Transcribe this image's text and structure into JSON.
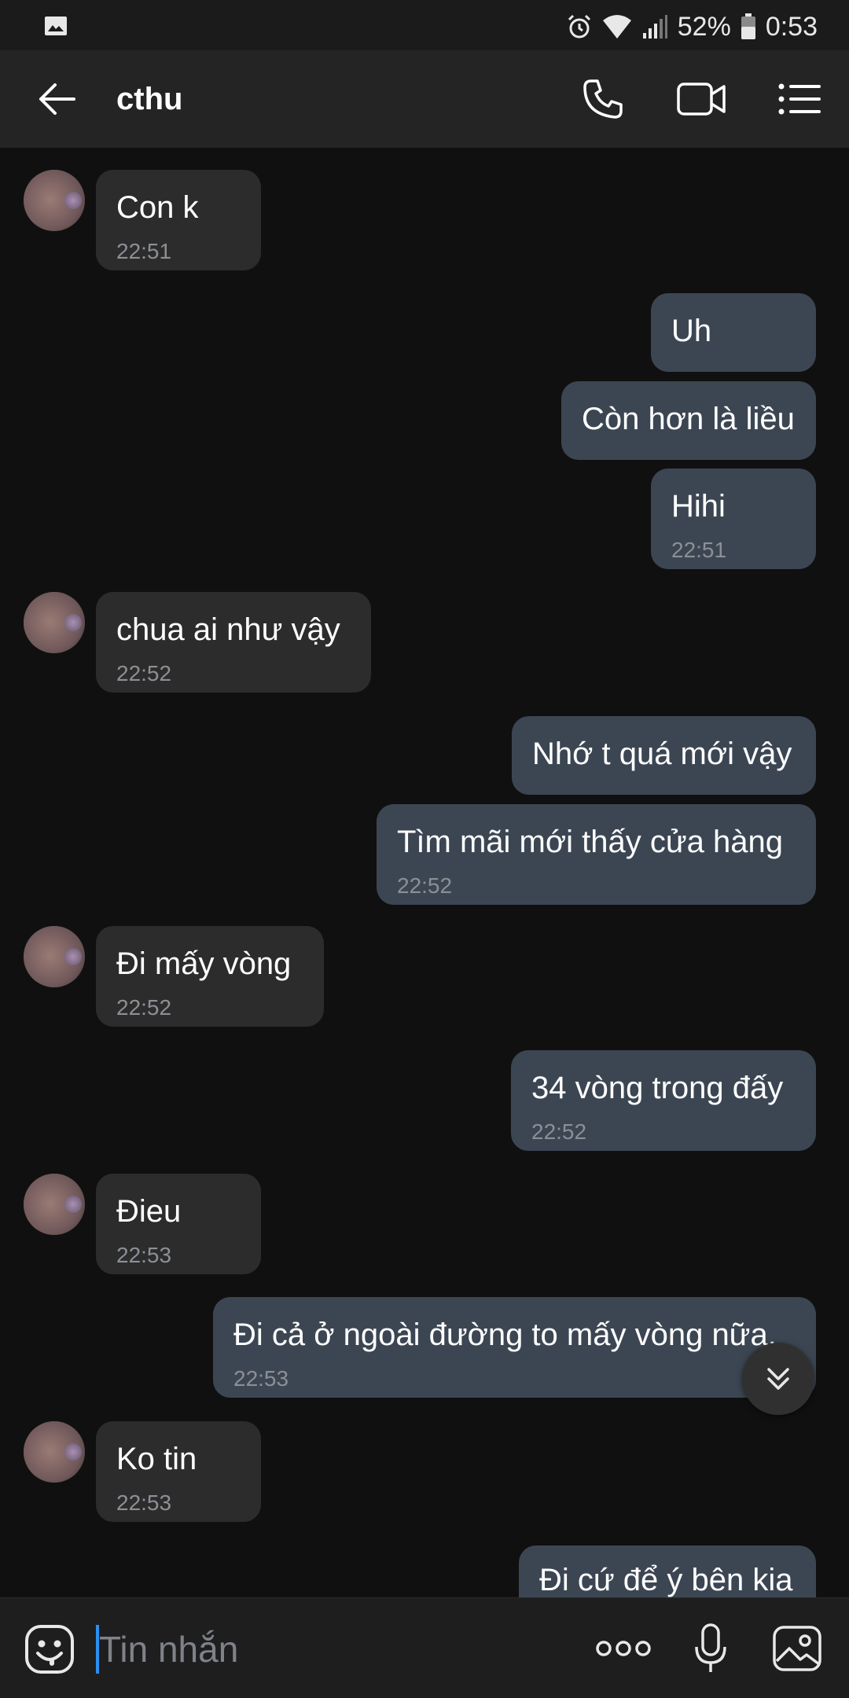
{
  "status_bar": {
    "battery_percent": "52%",
    "time": "0:53",
    "icons": [
      "image-icon",
      "alarm-icon",
      "wifi-icon",
      "signal-icon",
      "battery-icon"
    ]
  },
  "header": {
    "title": "cthu",
    "icons": [
      "back-arrow-icon",
      "phone-icon",
      "video-camera-icon",
      "menu-list-icon"
    ]
  },
  "messages": [
    {
      "side": "in",
      "text": "Con k",
      "time": "22:51"
    },
    {
      "side": "out",
      "text": "Uh",
      "time": ""
    },
    {
      "side": "out",
      "text": "Còn hơn là liều",
      "time": ""
    },
    {
      "side": "out",
      "text": "Hihi",
      "time": "22:51"
    },
    {
      "side": "in",
      "text": "chua ai như vậy",
      "time": "22:52"
    },
    {
      "side": "out",
      "text": "Nhớ t quá mới vậy",
      "time": ""
    },
    {
      "side": "out",
      "text": "Tìm mãi mới thấy cửa hàng",
      "time": "22:52"
    },
    {
      "side": "in",
      "text": "Đi mấy vòng",
      "time": "22:52"
    },
    {
      "side": "out",
      "text": "34 vòng trong đấy",
      "time": "22:52"
    },
    {
      "side": "in",
      "text": "Đieu",
      "time": "22:53"
    },
    {
      "side": "out",
      "text": "Đi cả ở ngoài đường to mấy vòng nữa.",
      "time": "22:53"
    },
    {
      "side": "in",
      "text": "Ko tin",
      "time": "22:53"
    },
    {
      "side": "out",
      "text": "Đi cứ để ý bên kia",
      "time": ""
    }
  ],
  "composer": {
    "placeholder": "Tin nhắn",
    "value": "",
    "icons": [
      "sticker-face-icon",
      "more-dots-icon",
      "microphone-icon",
      "gallery-image-icon"
    ]
  },
  "scroll_button_icon": "double-chevron-down-icon",
  "colors": {
    "background": "#101010",
    "incoming_bubble": "#2c2c2c",
    "outgoing_bubble": "#3c4653",
    "timestamp": "#8c8f95",
    "caret": "#2b8ff0"
  }
}
